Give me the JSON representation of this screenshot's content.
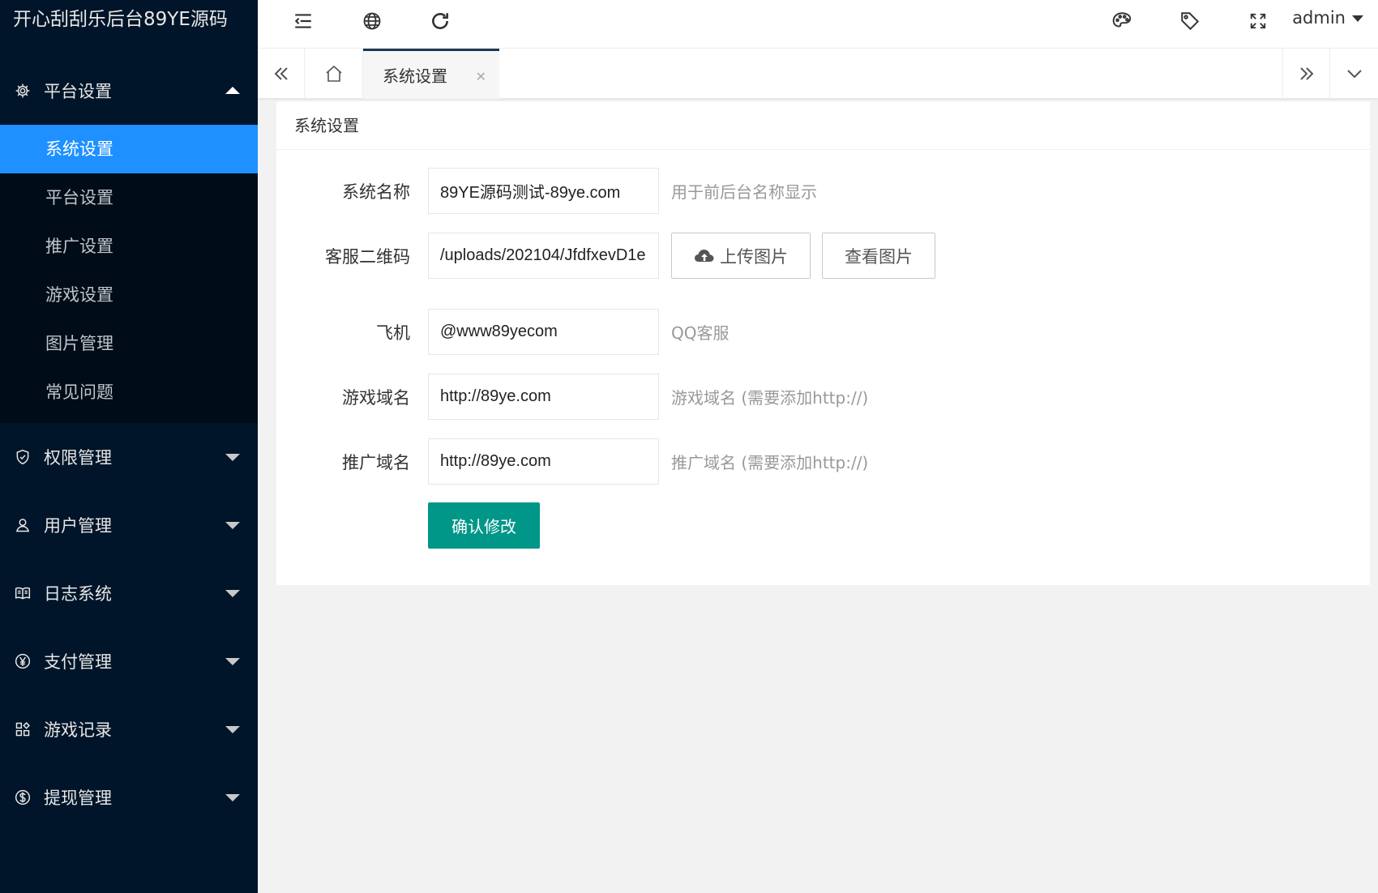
{
  "app": {
    "title": "开心刮刮乐后台89YE源码"
  },
  "sidebar": {
    "groups": [
      {
        "label": "平台设置",
        "icon": "gear-icon",
        "expanded": true,
        "items": [
          "系统设置",
          "平台设置",
          "推广设置",
          "游戏设置",
          "图片管理",
          "常见问题"
        ]
      },
      {
        "label": "权限管理",
        "icon": "shield-icon"
      },
      {
        "label": "用户管理",
        "icon": "user-icon"
      },
      {
        "label": "日志系统",
        "icon": "book-icon"
      },
      {
        "label": "支付管理",
        "icon": "yen-icon"
      },
      {
        "label": "游戏记录",
        "icon": "apps-icon"
      },
      {
        "label": "提现管理",
        "icon": "dollar-icon"
      }
    ],
    "active_item": "系统设置"
  },
  "header": {
    "icons": [
      "menu-fold-icon",
      "globe-icon",
      "refresh-icon",
      "palette-icon",
      "tag-icon",
      "fullscreen-icon"
    ],
    "user": "admin"
  },
  "tabs": {
    "active_label": "系统设置"
  },
  "card": {
    "title": "系统设置",
    "fields": [
      {
        "label": "系统名称",
        "value": "89YE源码测试-89ye.com",
        "tip": "用于前后台名称显示"
      },
      {
        "label": "客服二维码",
        "value": "/uploads/202104/JfdfxevD1e"
      },
      {
        "label": "飞机",
        "value": "@www89yecom",
        "tip": "QQ客服"
      },
      {
        "label": "游戏域名",
        "value": "http://89ye.com",
        "tip": "游戏域名 (需要添加http://)"
      },
      {
        "label": "推广域名",
        "value": "http://89ye.com",
        "tip": "推广域名 (需要添加http://)"
      }
    ],
    "upload_button": "上传图片",
    "view_button": "查看图片",
    "submit_button": "确认修改"
  },
  "colors": {
    "sidebar_bg": "#001529",
    "submenu_bg": "#000c17",
    "active_item": "#1e90ff",
    "primary_button": "#009688"
  }
}
